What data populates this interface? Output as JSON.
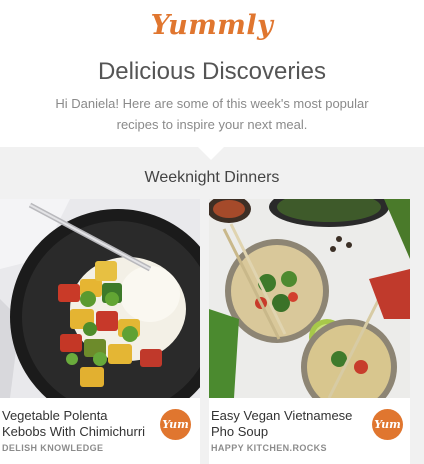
{
  "brand": {
    "logo": "Yummly",
    "accent": "#e0762f"
  },
  "header": {
    "headline": "Delicious Discoveries",
    "intro": "Hi Daniela! Here are some of this week's most popular recipes to inspire your next meal."
  },
  "section": {
    "title": "Weeknight Dinners",
    "cards": [
      {
        "title": "Vegetable Polenta Kebobs With Chimichurri",
        "source": "DELISH KNOWLEDGE",
        "button": "Yum",
        "image": "polenta-kebobs-photo"
      },
      {
        "title": "Easy Vegan Vietnamese Pho Soup",
        "source": "HAPPY KITCHEN.ROCKS",
        "button": "Yum",
        "image": "pho-soup-photo"
      }
    ]
  }
}
